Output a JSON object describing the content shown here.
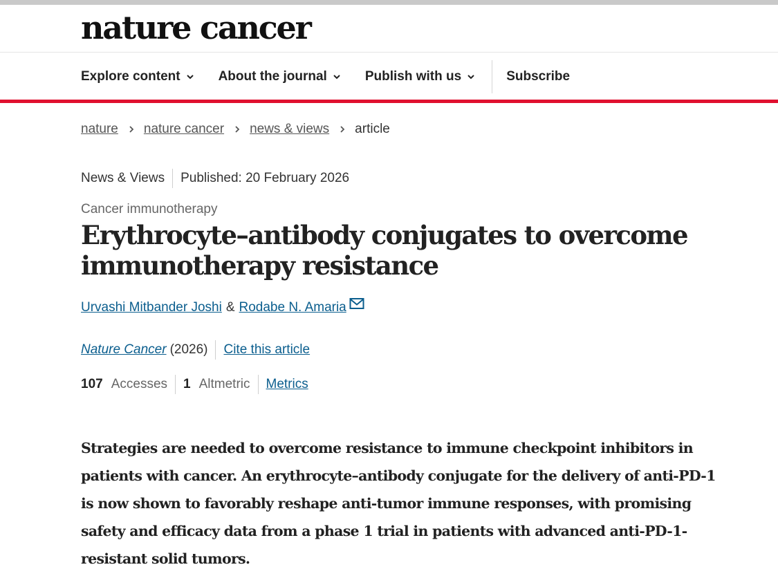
{
  "site": {
    "logo": "nature cancer"
  },
  "nav": {
    "items": [
      {
        "label": "Explore content",
        "has_dropdown": true
      },
      {
        "label": "About the journal",
        "has_dropdown": true
      },
      {
        "label": "Publish with us",
        "has_dropdown": true
      }
    ],
    "subscribe_label": "Subscribe"
  },
  "breadcrumb": {
    "items": [
      "nature",
      "nature cancer",
      "news & views"
    ],
    "current": "article"
  },
  "article": {
    "type": "News & Views",
    "published": "Published: 20 February 2026",
    "subject": "Cancer immunotherapy",
    "title": "Erythrocyte–antibody conjugates to overcome immunotherapy resistance",
    "authors": [
      "Urvashi Mitbander Joshi",
      "Rodabe N. Amaria"
    ],
    "author_separator": "&",
    "journal": "Nature Cancer",
    "year": "(2026)",
    "cite_label": "Cite this article",
    "metrics": {
      "accesses_count": "107",
      "accesses_label": "Accesses",
      "altmetric_count": "1",
      "altmetric_label": "Altmetric",
      "metrics_link": "Metrics"
    },
    "standfirst": "Strategies are needed to overcome resistance to immune checkpoint inhibitors in patients with cancer. An erythrocyte–antibody conjugate for the delivery of anti-PD-1 is now shown to favorably reshape anti-tumor immune responses, with promising safety and efficacy data from a phase 1 trial in patients with advanced anti-PD-1-resistant solid tumors."
  },
  "colors": {
    "accent_red": "#e0102f",
    "link_blue": "#0b5e8e",
    "text_dark": "#222222"
  },
  "icons": {
    "nav_dropdown": "chevron-down-icon",
    "breadcrumb_separator": "chevron-right-icon",
    "corresponding_author": "mail-icon"
  }
}
